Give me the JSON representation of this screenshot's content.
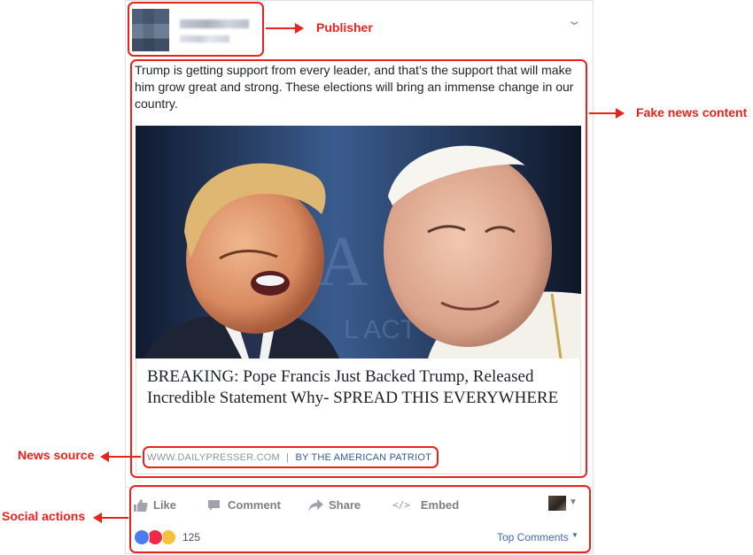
{
  "annotations": {
    "publisher": "Publisher",
    "fake_content": "Fake news content",
    "news_source": "News source",
    "social_actions": "Social actions"
  },
  "post": {
    "text": "Trump is getting support from every leader, and that’s the support that will make him grow great and strong. These elections will bring an immense change in our country.",
    "headline": "BREAKING: Pope Francis Just Backed Trump, Released Incredible Statement Why- SPREAD THIS EVERYWHERE",
    "source_domain": "WWW.DAILYPRESSER.COM",
    "source_sep": "|",
    "source_by": "BY THE AMERICAN PATRIOT"
  },
  "actions": {
    "like": "Like",
    "comment": "Comment",
    "share": "Share",
    "embed": "Embed"
  },
  "footer": {
    "reaction_count": "125",
    "top_comments": "Top Comments"
  },
  "colors": {
    "annotation_red": "#e8231c",
    "fb_blue": "#4267b2",
    "link_blue": "#365899"
  }
}
